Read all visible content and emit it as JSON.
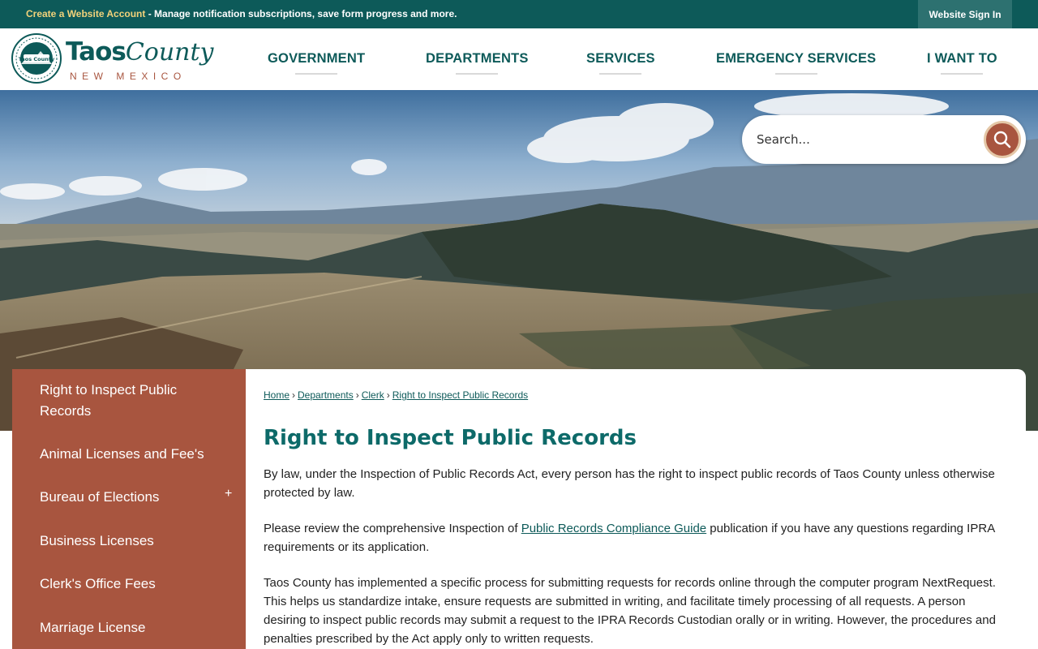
{
  "topbar": {
    "create_link": "Create a Website Account",
    "message": " - Manage notification subscriptions, save form progress and more.",
    "signin": "Website Sign In"
  },
  "logo": {
    "seal_text": "Taos County",
    "word_taos": "Taos",
    "word_county": "County",
    "sub": "NEW MEXICO"
  },
  "nav": [
    {
      "label": "GOVERNMENT"
    },
    {
      "label": "DEPARTMENTS"
    },
    {
      "label": "SERVICES"
    },
    {
      "label": "EMERGENCY SERVICES"
    },
    {
      "label": "I WANT TO"
    }
  ],
  "search": {
    "placeholder": "Search..."
  },
  "sidebar": {
    "items": [
      {
        "label": "Right to Inspect Public Records"
      },
      {
        "label": "Animal Licenses and Fee's"
      },
      {
        "label": "Bureau of Elections"
      },
      {
        "label": "Business Licenses"
      },
      {
        "label": "Clerk's Office Fees"
      },
      {
        "label": "Marriage License"
      }
    ],
    "expand": "+"
  },
  "breadcrumb": {
    "items": [
      "Home",
      "Departments",
      "Clerk",
      "Right to Inspect Public Records"
    ],
    "separator": "›"
  },
  "page": {
    "title": "Right to Inspect Public Records",
    "p1": "By law, under the Inspection of Public Records Act, every person has the right to inspect public records of Taos County unless otherwise protected by law.",
    "p2_before": "Please review the comprehensive Inspection of ",
    "p2_link": "Public Records Compliance Guide",
    "p2_after": " publication if you have any questions regarding IPRA requirements or its application.",
    "p3": "Taos County has implemented a specific process for submitting requests for records online through the computer program NextRequest. This helps us standardize intake, ensure requests are submitted in writing, and facilitate timely processing of all requests. A person desiring to inspect public records may submit a request to the IPRA Records Custodian orally or in writing. However, the procedures and penalties prescribed by the Act apply only to written requests."
  },
  "colors": {
    "teal": "#0d5a59",
    "rust": "#a8553f",
    "gold": "#f2d27a"
  }
}
